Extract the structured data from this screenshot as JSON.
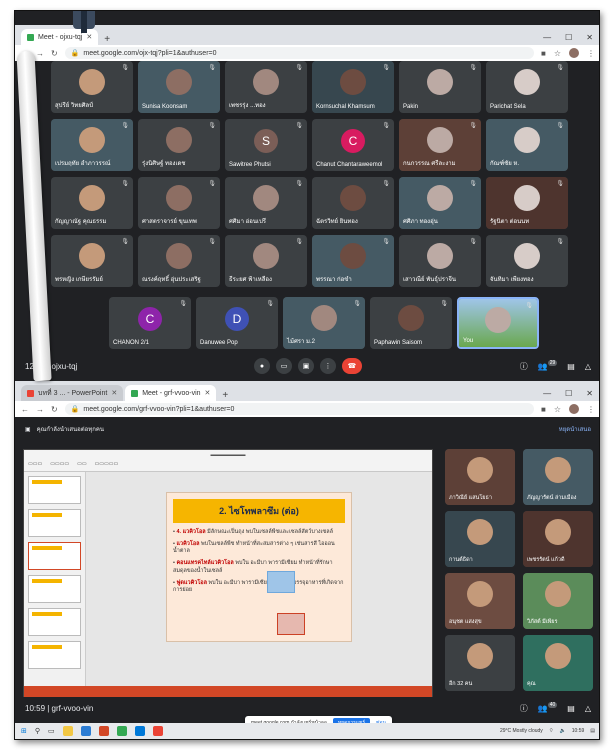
{
  "top_window": {
    "tabs": [
      {
        "label": "Meet - ojxu-tqj",
        "active": true
      },
      {
        "label": "+"
      }
    ],
    "url": "meet.google.com/ojx-tqj?pli=1&authuser=0",
    "participants": [
      {
        "name": "สุปรีย์ วิทยศิลป์"
      },
      {
        "name": "Sunisa Koonsam"
      },
      {
        "name": "เพชรรุ่ง ...ทอง"
      },
      {
        "name": "Kornsuchal Khamsum"
      },
      {
        "name": "Pakin"
      },
      {
        "name": "Parichat Sela"
      },
      {
        "name": "เปรมฤทัย อำภาวรรณ์"
      },
      {
        "name": "รุ่งนิศิษฐ์ ทองเดช"
      },
      {
        "name": "Sawitree Phutsi",
        "letter": "S",
        "color": "#7b5e57"
      },
      {
        "name": "Chanut Chantaraweemol",
        "letter": "C",
        "color": "#d81b60"
      },
      {
        "name": "กนกวรรณ ศรีละงาม"
      },
      {
        "name": "กัณฑ์ชัย ห."
      },
      {
        "name": "กัญญาณัฐ คุณธรรม"
      },
      {
        "name": "ศาสตราจารย์ ขุนเทพ"
      },
      {
        "name": "ศศิมา อ่อนเปรี"
      },
      {
        "name": "ฉัตรวิทย์ ยินทอง"
      },
      {
        "name": "ศศิภา ทองอุ่น"
      },
      {
        "name": "รัฐนิตา ต่อนนท"
      },
      {
        "name": "พรหญิง เกษียรรัมย์"
      },
      {
        "name": "ณรงค์ฤทธิ์ อุ่นประเสริฐ"
      },
      {
        "name": "ธีระยศ ฟ้าเหลือง"
      },
      {
        "name": "พรรณา ก่อขำ"
      },
      {
        "name": "เสาวณีย์ พันธุ์ปราจีน"
      },
      {
        "name": "จันทิมา เพียงทอง"
      },
      {
        "name": "CHANON 2/1",
        "letter": "C",
        "color": "#8e24aa"
      },
      {
        "name": "Danuwee Pop",
        "letter": "D",
        "color": "#3f51b5"
      },
      {
        "name": "ไม้ศรา ม.2"
      },
      {
        "name": "Paphawin Saisom"
      },
      {
        "name": "You"
      }
    ],
    "meeting_code": "12:10 | ojxu-tqj",
    "people_count": "29"
  },
  "bottom_window": {
    "tabs": [
      {
        "label": "บทที่ 3 ... - PowerPoint"
      },
      {
        "label": "Meet - grf-vvoo-vin",
        "active": true
      },
      {
        "label": "+"
      }
    ],
    "url": "meet.google.com/grf-vvoo-vin?pli=1&authuser=0",
    "presenting_banner": "คุณกำลังนำเสนอต่อทุกคน",
    "stop_presenting": "หยุดนำเสนอ",
    "slide": {
      "title": "2. ไซโทพลาซึม (ต่อ)",
      "bullets": [
        {
          "highlight": "4. แวคิวโอล",
          "text": " มีลักษณะเป็นถุง พบในเซลล์พืชและเซลล์สัตว์บางเซลล์"
        },
        {
          "highlight": "แวคิวโอล",
          "text": " พบในเซลล์พืช ทำหน้าที่สะสมสารต่าง ๆ เช่นสารสี ไอออน น้ำตาล"
        },
        {
          "highlight": "คอนแทรคไทล์แวคิวโอล",
          "text": " พบใน อะมีบา พารามีเซียม ทำหน้าที่รักษาสมดุลของน้ำในเซลล์"
        },
        {
          "highlight": "ฟูดแวคิวโอล",
          "text": " พบใน อะมีบา พารามีเซียม ทำหน้าที่บรรจุอาหารที่เกิดจากการย่อย"
        }
      ]
    },
    "side_participants": [
      {
        "name": "ภาวิณีย์ แสนโยธา"
      },
      {
        "name": "ภัญญารัตน์ ล่ามเมือง"
      },
      {
        "name": "กานต์ธิดา"
      },
      {
        "name": "เพชรรัตน์ แก้วดี"
      },
      {
        "name": "อนุชต แสงสุข"
      },
      {
        "name": "วิภัสต์ มีเพียร"
      },
      {
        "name": "อีก 32 คน"
      },
      {
        "name": "คุณ"
      }
    ],
    "meeting_code": "10:59 | grf-vvoo-vin",
    "people_count": "40",
    "sharing_text": "meet.google.com กำลังแชร์หน้าจอ",
    "stop_sharing": "หยุดการแชร์",
    "hide": "ซ่อน",
    "weather": "29°C Mostly cloudy",
    "clock": "10:59"
  }
}
